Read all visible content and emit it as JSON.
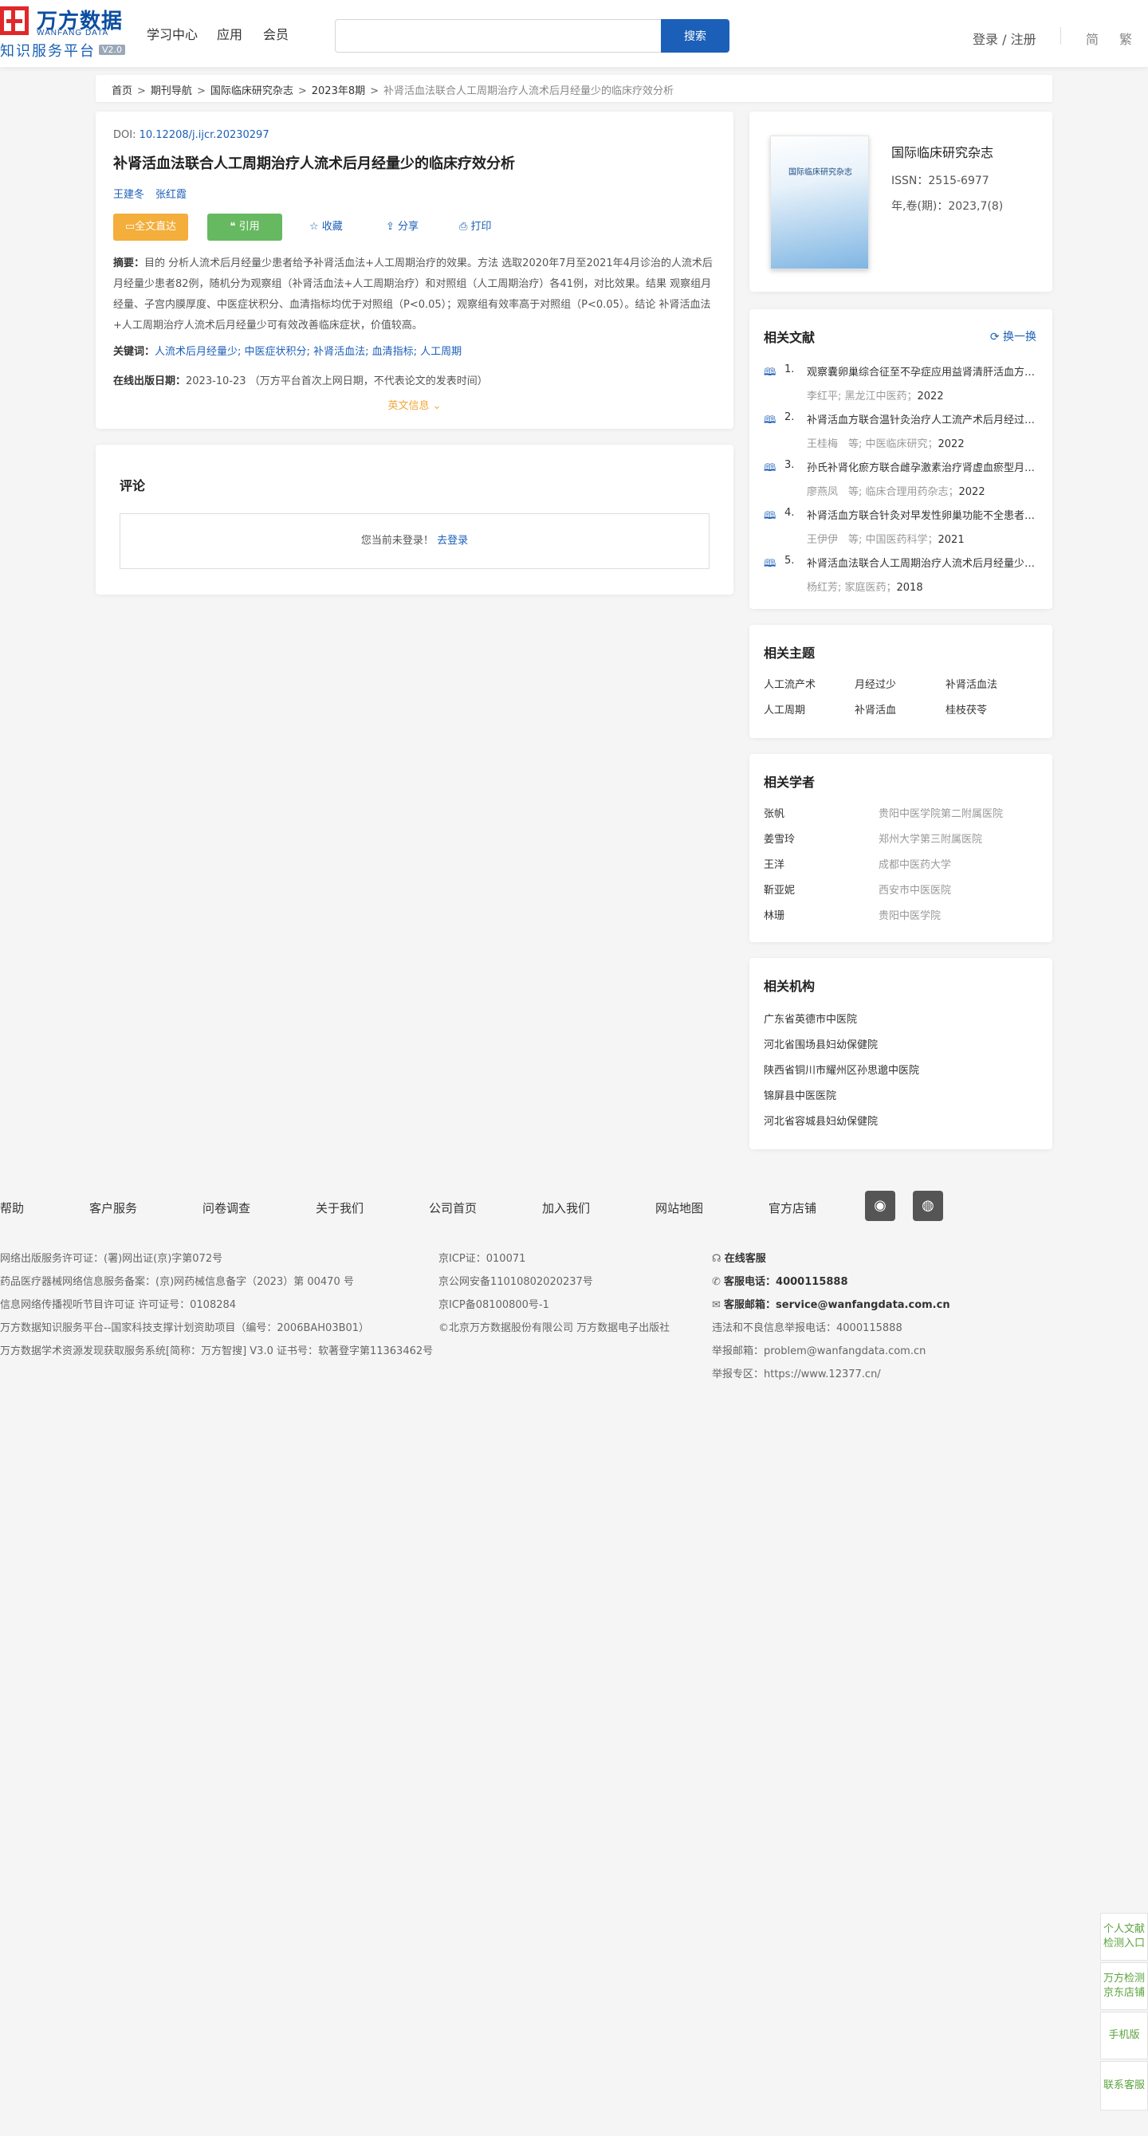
{
  "header": {
    "logo": {
      "cn": "万方数据",
      "en": "WANFANG DATA",
      "sub": "知识服务平台",
      "version": "V2.0"
    },
    "nav": [
      "学习中心",
      "应用",
      "会员"
    ],
    "search": {
      "placeholder": "",
      "button": "搜索"
    },
    "login": "登录 / 注册",
    "lang": [
      "简",
      "繁"
    ]
  },
  "breadcrumb": [
    "首页",
    "期刊导航",
    "国际临床研究杂志",
    "2023年8期",
    "补肾活血法联合人工周期治疗人流术后月经量少的临床疗效分析"
  ],
  "article": {
    "doi_label": "DOI:",
    "doi": "10.12208/j.ijcr.20230297",
    "title": "补肾活血法联合人工周期治疗人流术后月经量少的临床疗效分析",
    "authors": [
      "王建冬",
      "张红霞"
    ],
    "actions": {
      "fulltext": "全文直达",
      "cite": "引用",
      "collect": "收藏",
      "share": "分享",
      "print": "打印"
    },
    "abstract_label": "摘要：",
    "abstract": "目的 分析人流术后月经量少患者给予补肾活血法+人工周期治疗的效果。方法 选取2020年7月至2021年4月诊治的人流术后月经量少患者82例，随机分为观察组（补肾活血法+人工周期治疗）和对照组（人工周期治疗）各41例，对比效果。结果 观察组月经量、子宫内膜厚度、中医症状积分、血清指标均优于对照组（P<0.05）；观察组有效率高于对照组（P<0.05）。结论 补肾活血法+人工周期治疗人流术后月经量少可有效改善临床症状，价值较高。",
    "keywords_label": "关键词：",
    "keywords": [
      "人流术后月经量少;",
      "中医症状积分;",
      "补肾活血法;",
      "血清指标;",
      "人工周期"
    ],
    "online_label": "在线出版日期：",
    "online_date": "2023-10-23",
    "online_note": "（万方平台首次上网日期，不代表论文的发表时间）",
    "english_info": "英文信息"
  },
  "comments": {
    "title": "评论",
    "notice": "您当前未登录！",
    "login_link": "去登录"
  },
  "journal": {
    "cover_title": "国际临床研究杂志",
    "name": "国际临床研究杂志",
    "issn": "ISSN：2515-6977",
    "year": "年,卷(期)：2023,7(8)"
  },
  "related": {
    "title": "相关文献",
    "refresh": "换一换",
    "items": [
      {
        "num": "1.",
        "title": "观察囊卵巢综合征至不孕症应用益肾清肝活血方治疗的效果",
        "meta": "李红平; 黑龙江中医药；",
        "year": "2022"
      },
      {
        "num": "2.",
        "title": "补肾活血方联合温针灸治疗人工流产术后月经过少的临床观察",
        "meta": "王桂梅　等; 中医临床研究；",
        "year": "2022"
      },
      {
        "num": "3.",
        "title": "孙氏补肾化瘀方联合雌孕激素治疗肾虚血瘀型月经过少",
        "meta": "廖燕凤　等; 临床合理用药杂志；",
        "year": "2022"
      },
      {
        "num": "4.",
        "title": "补肾活血方联合针灸对早发性卵巢功能不全患者的影响",
        "meta": "王伊伊　等; 中国医药科学；",
        "year": "2021"
      },
      {
        "num": "5.",
        "title": "补肾活血法联合人工周期治疗人流术后月经量少的效果",
        "meta": "杨红芳; 家庭医药；",
        "year": "2018"
      }
    ]
  },
  "topics": {
    "title": "相关主题",
    "items": [
      "人工流产术",
      "月经过少",
      "补肾活血法",
      "人工周期",
      "补肾活血",
      "桂枝茯苓"
    ]
  },
  "scholars": {
    "title": "相关学者",
    "items": [
      {
        "name": "张帆",
        "org": "贵阳中医学院第二附属医院"
      },
      {
        "name": "姜雪玲",
        "org": "郑州大学第三附属医院"
      },
      {
        "name": "王洋",
        "org": "成都中医药大学"
      },
      {
        "name": "靳亚妮",
        "org": "西安市中医医院"
      },
      {
        "name": "林珊",
        "org": "贵阳中医学院"
      }
    ]
  },
  "orgs": {
    "title": "相关机构",
    "items": [
      "广东省英德市中医院",
      "河北省围场县妇幼保健院",
      "陕西省铜川市耀州区孙思邈中医院",
      "锦屏县中医医院",
      "河北省容城县妇幼保健院"
    ]
  },
  "footer": {
    "links": [
      "帮助",
      "客户服务",
      "问卷调查",
      "关于我们",
      "公司首页",
      "加入我们",
      "网站地图",
      "官方店铺"
    ],
    "social": [
      "weibo-icon",
      "wechat-icon"
    ],
    "col1": [
      "网络出版服务许可证：(署)网出证(京)字第072号",
      "药品医疗器械网络信息服务备案：(京)网药械信息备字（2023）第 00470 号",
      "信息网络传播视听节目许可证 许可证号：0108284",
      "万方数据知识服务平台--国家科技支撑计划资助项目（编号：2006BAH03B01）",
      "万方数据学术资源发现获取服务系统[简称：万方智搜] V3.0 证书号：软著登字第11363462号"
    ],
    "col2": [
      "京ICP证：010071",
      "京公网安备11010802020237号",
      "京ICP备08100800号-1",
      "©北京万方数据股份有限公司 万方数据电子出版社"
    ],
    "col3": {
      "online_service": "在线客服",
      "phone_label": "客服电话：",
      "phone": "4000115888",
      "email_label": "客服邮箱：",
      "email": "service@wanfangdata.com.cn",
      "report_phone": "违法和不良信息举报电话：4000115888",
      "report_email": "举报邮箱：problem@wanfangdata.com.cn",
      "report_zone": "举报专区：https://www.12377.cn/"
    }
  },
  "float_tools": [
    "个人文献检测入口",
    "万方检测京东店铺",
    "手机版",
    "联系客服"
  ]
}
